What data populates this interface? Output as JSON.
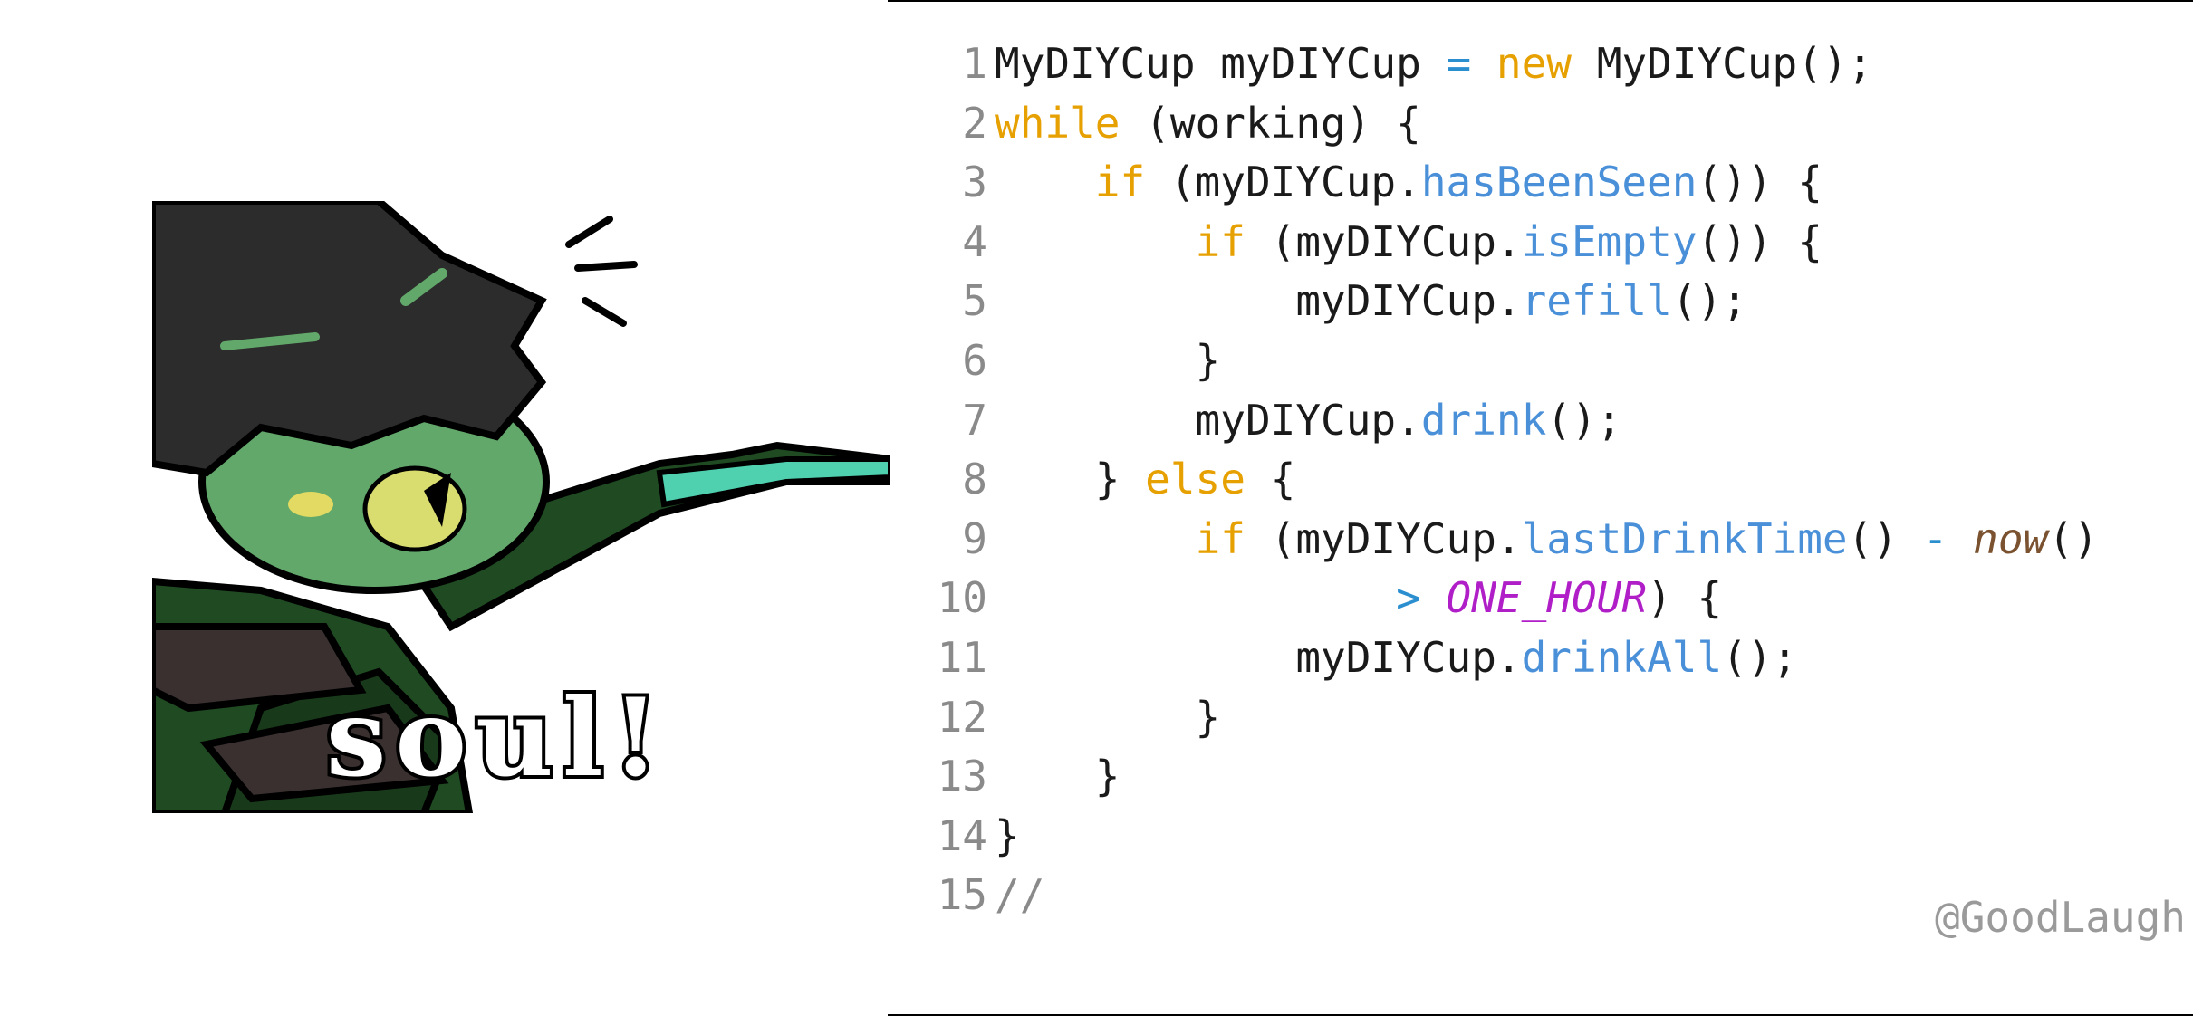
{
  "meme": {
    "caption": "soul!"
  },
  "code": {
    "lines": [
      {
        "n": "1",
        "tokens": [
          {
            "t": "MyDIYCup myDIYCup ",
            "k": "plain"
          },
          {
            "t": "=",
            "k": "op"
          },
          {
            "t": " ",
            "k": "plain"
          },
          {
            "t": "new",
            "k": "kw"
          },
          {
            "t": " MyDIYCup();",
            "k": "plain"
          }
        ]
      },
      {
        "n": "2",
        "tokens": [
          {
            "t": "while",
            "k": "kw"
          },
          {
            "t": " (working) {",
            "k": "plain"
          }
        ]
      },
      {
        "n": "3",
        "tokens": [
          {
            "t": "    ",
            "k": "plain"
          },
          {
            "t": "if",
            "k": "kw"
          },
          {
            "t": " (myDIYCup.",
            "k": "plain"
          },
          {
            "t": "hasBeenSeen",
            "k": "fn"
          },
          {
            "t": "()) {",
            "k": "plain"
          }
        ]
      },
      {
        "n": "4",
        "tokens": [
          {
            "t": "        ",
            "k": "plain"
          },
          {
            "t": "if",
            "k": "kw"
          },
          {
            "t": " (myDIYCup.",
            "k": "plain"
          },
          {
            "t": "isEmpty",
            "k": "fn"
          },
          {
            "t": "()) {",
            "k": "plain"
          }
        ]
      },
      {
        "n": "5",
        "tokens": [
          {
            "t": "            myDIYCup.",
            "k": "plain"
          },
          {
            "t": "refill",
            "k": "fn"
          },
          {
            "t": "();",
            "k": "plain"
          }
        ]
      },
      {
        "n": "6",
        "tokens": [
          {
            "t": "        }",
            "k": "plain"
          }
        ]
      },
      {
        "n": "7",
        "tokens": [
          {
            "t": "        myDIYCup.",
            "k": "plain"
          },
          {
            "t": "drink",
            "k": "fn"
          },
          {
            "t": "();",
            "k": "plain"
          }
        ]
      },
      {
        "n": "8",
        "tokens": [
          {
            "t": "    } ",
            "k": "plain"
          },
          {
            "t": "else",
            "k": "kw"
          },
          {
            "t": " {",
            "k": "plain"
          }
        ]
      },
      {
        "n": "9",
        "tokens": [
          {
            "t": "        ",
            "k": "plain"
          },
          {
            "t": "if",
            "k": "kw"
          },
          {
            "t": " (myDIYCup.",
            "k": "plain"
          },
          {
            "t": "lastDrinkTime",
            "k": "fn"
          },
          {
            "t": "() ",
            "k": "plain"
          },
          {
            "t": "-",
            "k": "op"
          },
          {
            "t": " ",
            "k": "plain"
          },
          {
            "t": "now",
            "k": "call"
          },
          {
            "t": "()",
            "k": "plain"
          }
        ]
      },
      {
        "n": "10",
        "tokens": [
          {
            "t": "                ",
            "k": "plain"
          },
          {
            "t": ">",
            "k": "op"
          },
          {
            "t": " ",
            "k": "plain"
          },
          {
            "t": "ONE_HOUR",
            "k": "const"
          },
          {
            "t": ") {",
            "k": "plain"
          }
        ]
      },
      {
        "n": "11",
        "tokens": [
          {
            "t": "            myDIYCup.",
            "k": "plain"
          },
          {
            "t": "drinkAll",
            "k": "fn"
          },
          {
            "t": "();",
            "k": "plain"
          }
        ]
      },
      {
        "n": "12",
        "tokens": [
          {
            "t": "        }",
            "k": "plain"
          }
        ]
      },
      {
        "n": "13",
        "tokens": [
          {
            "t": "    }",
            "k": "plain"
          }
        ]
      },
      {
        "n": "14",
        "tokens": [
          {
            "t": "}",
            "k": "plain"
          }
        ]
      },
      {
        "n": "15",
        "tokens": [
          {
            "t": "//",
            "k": "comment"
          }
        ]
      }
    ]
  },
  "watermark": "@GoodLaugh"
}
